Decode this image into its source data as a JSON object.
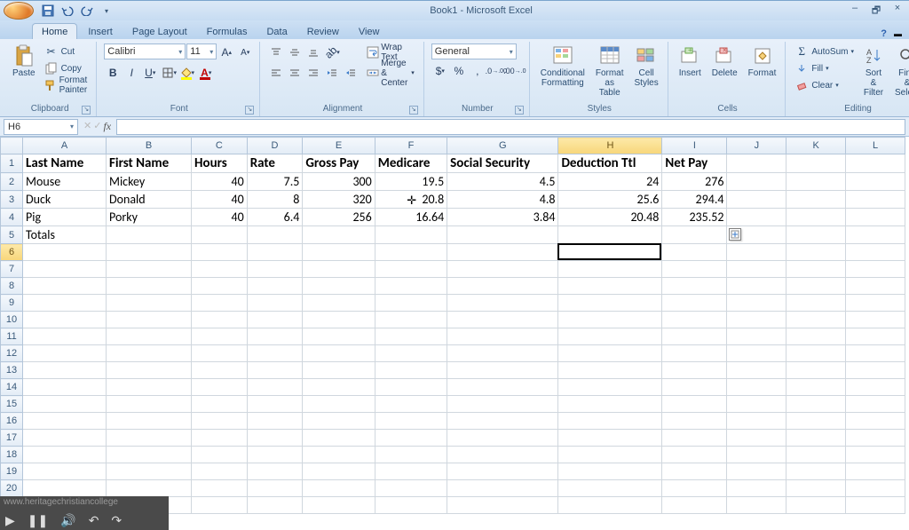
{
  "title": "Book1 - Microsoft Excel",
  "tabs": [
    "Home",
    "Insert",
    "Page Layout",
    "Formulas",
    "Data",
    "Review",
    "View"
  ],
  "active_tab": "Home",
  "clipboard": {
    "paste": "Paste",
    "cut": "Cut",
    "copy": "Copy",
    "format_painter": "Format Painter",
    "label": "Clipboard"
  },
  "font": {
    "name": "Calibri",
    "size": "11",
    "label": "Font"
  },
  "alignment": {
    "wrap": "Wrap Text",
    "merge": "Merge & Center",
    "label": "Alignment"
  },
  "number": {
    "format": "General",
    "label": "Number"
  },
  "styles": {
    "cond": "Conditional Formatting",
    "table": "Format as Table",
    "cell": "Cell Styles",
    "label": "Styles"
  },
  "cells": {
    "insert": "Insert",
    "delete": "Delete",
    "format": "Format",
    "label": "Cells"
  },
  "editing": {
    "sum": "AutoSum",
    "fill": "Fill",
    "clear": "Clear",
    "sort": "Sort & Filter",
    "find": "Find & Select",
    "label": "Editing"
  },
  "namebox": "H6",
  "formula": "",
  "columns": [
    "A",
    "B",
    "C",
    "D",
    "E",
    "F",
    "G",
    "H",
    "I",
    "J",
    "K",
    "L"
  ],
  "selected_col": "H",
  "selected_row": 6,
  "headers": [
    "Last Name",
    "First Name",
    "Hours",
    "Rate",
    "Gross Pay",
    "Medicare",
    "Social Security",
    "Deduction Ttl",
    "Net Pay"
  ],
  "rows": [
    {
      "last": "Mouse",
      "first": "Mickey",
      "hours": 40,
      "rate": 7.5,
      "gross": 300,
      "medicare": 19.5,
      "ss": 4.5,
      "ded": 24,
      "net": 276
    },
    {
      "last": "Duck",
      "first": "Donald",
      "hours": 40,
      "rate": 8,
      "gross": 320,
      "medicare": 20.8,
      "ss": 4.8,
      "ded": 25.6,
      "net": 294.4
    },
    {
      "last": "Pig",
      "first": "Porky",
      "hours": 40,
      "rate": 6.4,
      "gross": 256,
      "medicare": 16.64,
      "ss": 3.84,
      "ded": 20.48,
      "net": 235.52
    }
  ],
  "totals_label": "Totals",
  "overlay_site": "www.heritagechristiancollege"
}
